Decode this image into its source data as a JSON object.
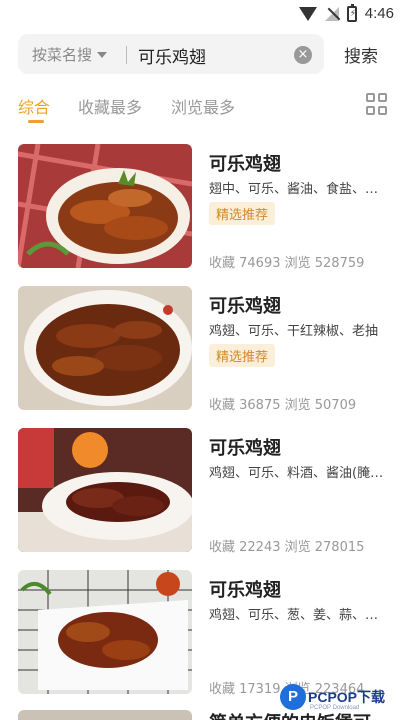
{
  "status_bar": {
    "time": "4:46"
  },
  "search": {
    "mode_label": "按菜名搜",
    "query": "可乐鸡翅",
    "submit_label": "搜索"
  },
  "tabs": [
    {
      "label": "综合",
      "active": true
    },
    {
      "label": "收藏最多",
      "active": false
    },
    {
      "label": "浏览最多",
      "active": false
    }
  ],
  "view_toggle_icon": "grid-view-icon",
  "accent_color": "#f0a030",
  "recipes": [
    {
      "title": "可乐鸡翅",
      "ingredients": "翅中、可乐、酱油、食盐、…",
      "badge": "精选推荐",
      "stats": "收藏 74693 浏览 528759"
    },
    {
      "title": "可乐鸡翅",
      "ingredients": "鸡翅、可乐、干红辣椒、老抽",
      "badge": "精选推荐",
      "stats": "收藏 36875 浏览 50709"
    },
    {
      "title": "可乐鸡翅",
      "ingredients": "鸡翅、可乐、料酒、酱油(腌…",
      "badge": "",
      "stats": "收藏 22243 浏览 278015"
    },
    {
      "title": "可乐鸡翅",
      "ingredients": "鸡翅、可乐、葱、姜、蒜、…",
      "badge": "",
      "stats": "收藏 17319 浏览 223464"
    }
  ],
  "partial_next_title": "简单方便的电饭煲可",
  "watermark": {
    "logo_letter": "P",
    "text": "PCPOP下载",
    "sub": "PCPOP Download"
  }
}
